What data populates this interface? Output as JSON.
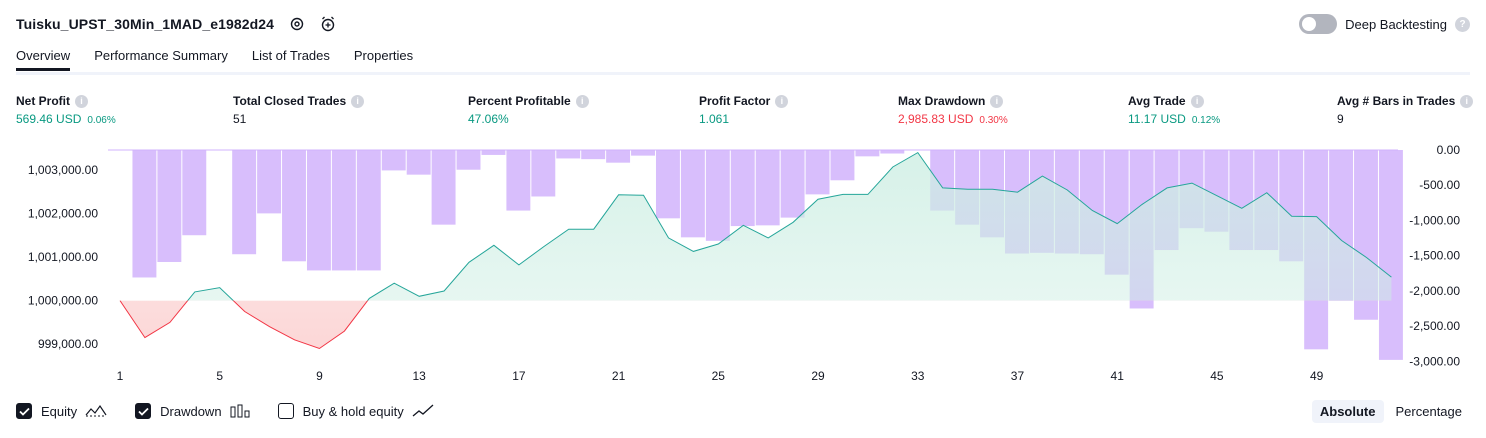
{
  "header": {
    "strategy_name": "Tuisku_UPST_30Min_1MAD_e1982d24",
    "icons": [
      "settings-icon",
      "alarm-add-icon"
    ],
    "deep_backtesting_label": "Deep Backtesting",
    "deep_backtesting_enabled": false
  },
  "tabs": [
    {
      "label": "Overview",
      "active": true
    },
    {
      "label": "Performance Summary",
      "active": false
    },
    {
      "label": "List of Trades",
      "active": false
    },
    {
      "label": "Properties",
      "active": false
    }
  ],
  "metrics": [
    {
      "label": "Net Profit",
      "value": "569.46 USD",
      "pct": "0.06%",
      "color": "#089981"
    },
    {
      "label": "Total Closed Trades",
      "value": "51",
      "pct": "",
      "color": "#131722"
    },
    {
      "label": "Percent Profitable",
      "value": "47.06%",
      "pct": "",
      "color": "#089981"
    },
    {
      "label": "Profit Factor",
      "value": "1.061",
      "pct": "",
      "color": "#089981"
    },
    {
      "label": "Max Drawdown",
      "value": "2,985.83 USD",
      "pct": "0.30%",
      "color": "#f23645"
    },
    {
      "label": "Avg Trade",
      "value": "11.17 USD",
      "pct": "0.12%",
      "color": "#089981"
    },
    {
      "label": "Avg # Bars in Trades",
      "value": "9",
      "pct": "",
      "color": "#131722"
    }
  ],
  "legend": {
    "equity_label": "Equity",
    "equity_checked": true,
    "drawdown_label": "Drawdown",
    "drawdown_checked": true,
    "buyhold_label": "Buy & hold equity",
    "buyhold_checked": false
  },
  "mode": {
    "absolute_label": "Absolute",
    "percentage_label": "Percentage",
    "active": "Absolute"
  },
  "colors": {
    "profit": "#089981",
    "loss": "#f23645",
    "drawdown_bar": "#d1b3fc",
    "equity_fill_pos": "#cdeee3",
    "equity_fill_neg": "#fcd5d5",
    "equity_line": "#26a69a"
  },
  "chart_data": {
    "type": "area",
    "x": [
      1,
      2,
      3,
      4,
      5,
      6,
      7,
      8,
      9,
      10,
      11,
      12,
      13,
      14,
      15,
      16,
      17,
      18,
      19,
      20,
      21,
      22,
      23,
      24,
      25,
      26,
      27,
      28,
      29,
      30,
      31,
      32,
      33,
      34,
      35,
      36,
      37,
      38,
      39,
      40,
      41,
      42,
      43,
      44,
      45,
      46,
      47,
      48,
      49,
      50,
      51,
      52
    ],
    "x_ticks": [
      1,
      5,
      9,
      13,
      17,
      21,
      25,
      29,
      33,
      37,
      41,
      45,
      49
    ],
    "series": [
      {
        "type": "line",
        "axis": "left",
        "values": [
          1000000,
          999150,
          999500,
          1000200,
          1000300,
          999750,
          999400,
          999100,
          998900,
          999300,
          1000050,
          1000400,
          1000100,
          1000220,
          1000880,
          1001270,
          1000820,
          1001240,
          1001640,
          1001640,
          1002430,
          1002420,
          1001440,
          1001130,
          1001300,
          1001730,
          1001440,
          1001800,
          1002330,
          1002440,
          1002440,
          1003070,
          1003400,
          1002590,
          1002560,
          1002560,
          1002490,
          1002860,
          1002540,
          1002070,
          1001770,
          1002210,
          1002590,
          1002700,
          1002410,
          1002120,
          1002480,
          1001940,
          1001930,
          1001380,
          1000990,
          1000540
        ]
      },
      {
        "type": "bar",
        "axis": "right",
        "values": [
          0,
          -1810,
          -1590,
          -1210,
          0,
          -1480,
          -900,
          -1580,
          -1710,
          -1710,
          -1710,
          -290,
          -350,
          -1060,
          -280,
          -70,
          -860,
          -660,
          -120,
          -130,
          -180,
          -80,
          -970,
          -1240,
          -1290,
          -1080,
          -1070,
          -960,
          -630,
          -430,
          -90,
          -50,
          0,
          -860,
          -1060,
          -1240,
          -1470,
          -1460,
          -1470,
          -1480,
          -1770,
          -2250,
          -1420,
          -1110,
          -1160,
          -1420,
          -1420,
          -1580,
          -2830,
          -2140,
          -2410,
          -2980
        ]
      }
    ],
    "y_left_ticks": [
      "1,003,000.00",
      "1,002,000.00",
      "1,001,000.00",
      "1,000,000.00",
      "999,000.00"
    ],
    "y_right_ticks": [
      "0.00",
      "-500.00",
      "-1,000.00",
      "-1,500.00",
      "-2,000.00",
      "-2,500.00",
      "-3,000.00"
    ],
    "y_left_range": [
      998590,
      1003460
    ],
    "y_right_range": [
      -3010,
      0
    ],
    "baseline": 1000000
  }
}
